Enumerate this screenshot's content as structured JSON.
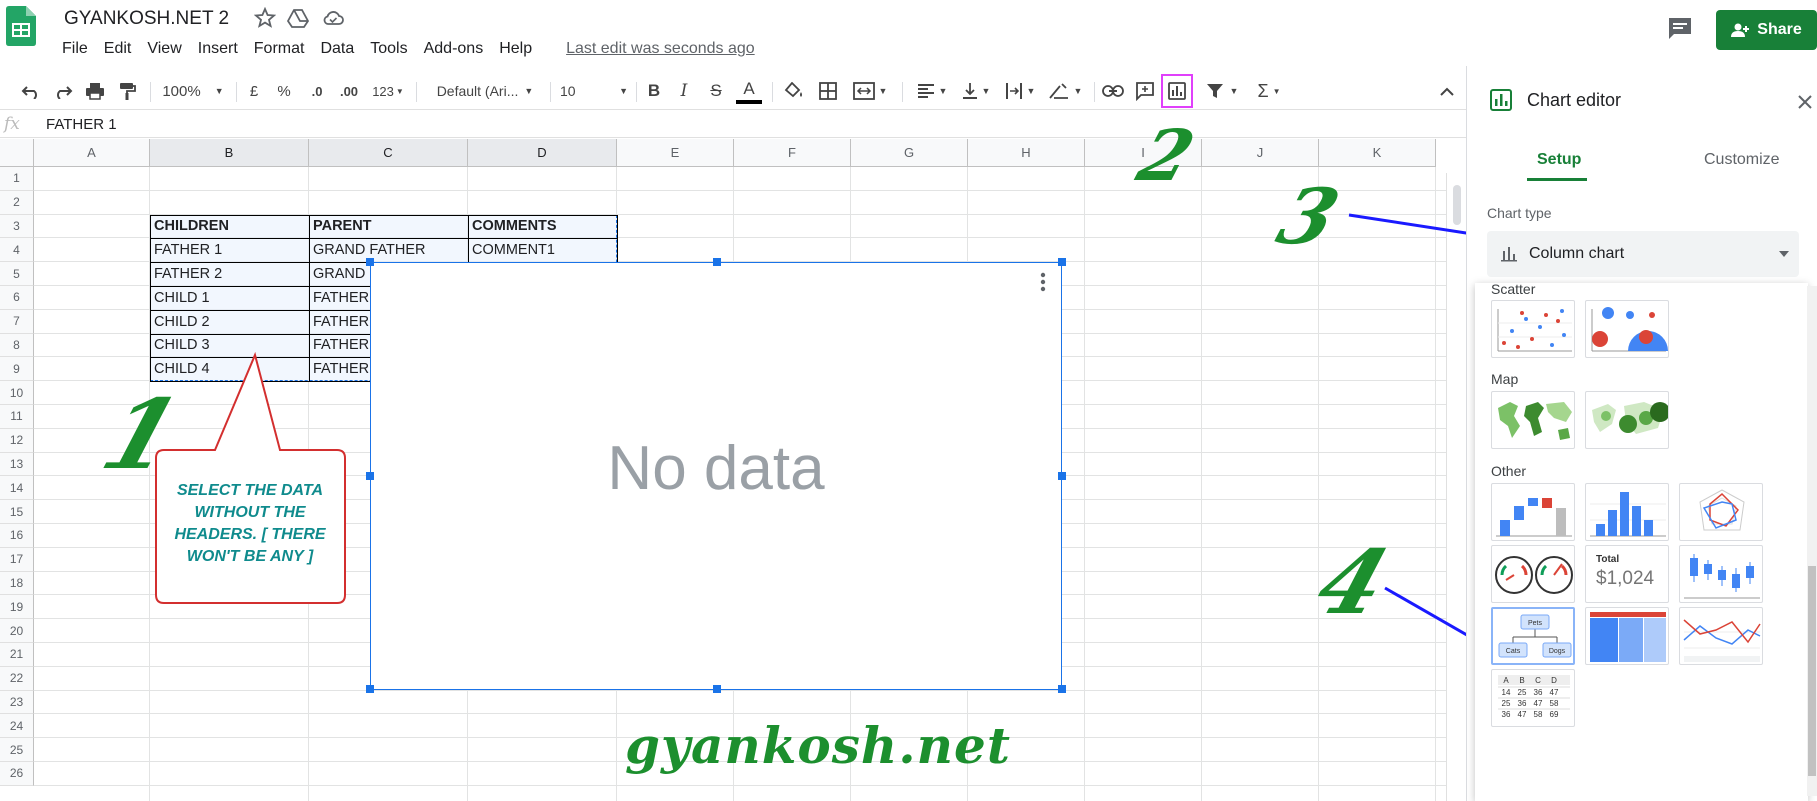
{
  "header": {
    "doc_title": "GYANKOSH.NET 2",
    "menu": [
      "File",
      "Edit",
      "View",
      "Insert",
      "Format",
      "Data",
      "Tools",
      "Add-ons",
      "Help"
    ],
    "last_edit": "Last edit was seconds ago",
    "share_label": "Share"
  },
  "toolbar": {
    "zoom": "100%",
    "currency": "£",
    "percent": "%",
    "dec_less": ".0",
    "dec_more": ".00",
    "format_more": "123",
    "font": "Default (Ari...",
    "font_size": "10",
    "bold": "B",
    "italic": "I",
    "strike": "S",
    "text_color": "A",
    "sigma": "Σ"
  },
  "formula_bar": {
    "fx": "fx",
    "value": "FATHER 1"
  },
  "grid": {
    "columns": [
      "A",
      "B",
      "C",
      "D",
      "E",
      "F",
      "G",
      "H",
      "I",
      "J",
      "K"
    ],
    "rows": [
      "1",
      "2",
      "3",
      "4",
      "5",
      "6",
      "7",
      "8",
      "9",
      "10",
      "11",
      "12",
      "13",
      "14",
      "15",
      "16",
      "17",
      "18",
      "19",
      "20",
      "21",
      "22",
      "23",
      "24",
      "25",
      "26"
    ],
    "headers": [
      "CHILDREN",
      "PARENT",
      "COMMENTS"
    ],
    "data": [
      [
        "FATHER 1",
        "GRAND FATHER",
        "COMMENT1"
      ],
      [
        "FATHER 2",
        "GRAND",
        ""
      ],
      [
        "CHILD 1",
        "FATHER",
        ""
      ],
      [
        "CHILD 2",
        "FATHER",
        ""
      ],
      [
        "CHILD 3",
        "FATHER",
        ""
      ],
      [
        "CHILD 4",
        "FATHER",
        ""
      ]
    ]
  },
  "chart": {
    "no_data": "No data"
  },
  "annotations": {
    "step1": "1",
    "step2": "2",
    "step3": "3",
    "step4": "4",
    "callout": "SELECT THE DATA WITHOUT THE HEADERS. [ THERE WON'T BE ANY ]",
    "watermark": "gyankosh.net"
  },
  "sidebar": {
    "title": "Chart editor",
    "tab_setup": "Setup",
    "tab_customize": "Customize",
    "chart_type_label": "Chart type",
    "chart_type_value": "Column chart",
    "sections": {
      "scatter": "Scatter",
      "map": "Map",
      "other": "Other"
    },
    "scorecard_total": "Total",
    "scorecard_value": "$1,024",
    "org_labels": [
      "Pets",
      "Cats",
      "Dogs"
    ],
    "table_thumb": {
      "head": [
        "A",
        "B",
        "C",
        "D"
      ],
      "rows": [
        [
          "14",
          "25",
          "36",
          "47"
        ],
        [
          "25",
          "36",
          "47",
          "58"
        ],
        [
          "36",
          "47",
          "58",
          "69"
        ]
      ]
    }
  },
  "colors": {
    "share_green": "#188038",
    "selection_blue": "#1a73e8",
    "annotation_green": "#1c8f2e",
    "arrow_blue": "#1a1aff",
    "callout_red": "#d32f2f",
    "callout_text": "#0f8b8d",
    "highlight_magenta": "#e040fb"
  }
}
